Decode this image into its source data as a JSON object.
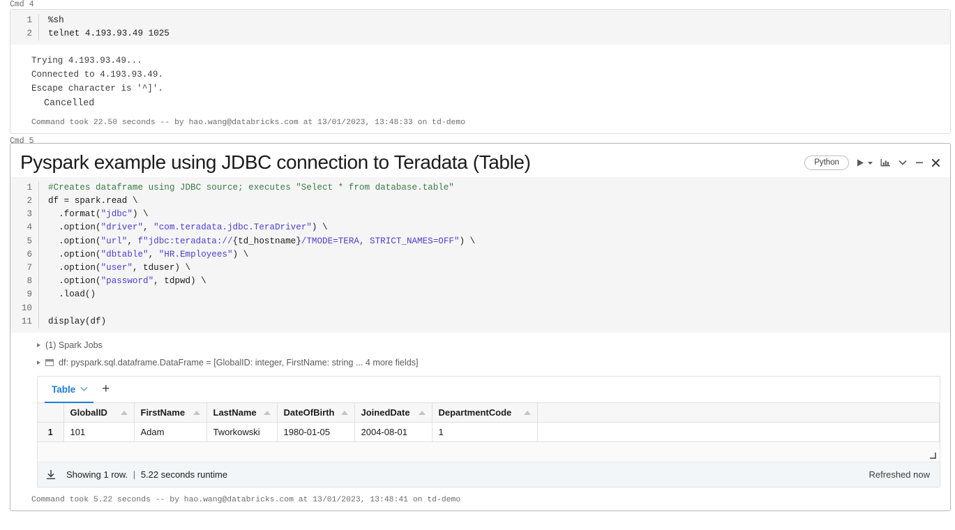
{
  "cmd4": {
    "label": "Cmd 4",
    "code_lines": [
      {
        "n": "1",
        "tokens": [
          {
            "t": "%sh",
            "c": "plain"
          }
        ]
      },
      {
        "n": "2",
        "tokens": [
          {
            "t": "telnet 4.193.93.49 1025",
            "c": "plain"
          }
        ]
      }
    ],
    "output_lines": [
      "Trying 4.193.93.49...",
      "Connected to 4.193.93.49.",
      "Escape character is '^]'."
    ],
    "cancelled": "Cancelled",
    "status": "Command took 22.50 seconds -- by hao.wang@databricks.com at 13/01/2023, 13:48:33 on td-demo"
  },
  "cmd5": {
    "label": "Cmd 5",
    "title": "Pyspark example using JDBC connection to Teradata (Table)",
    "toolbar": {
      "language": "Python",
      "run_icon": "play-icon",
      "run_caret_icon": "caret-down-icon",
      "chart_icon": "bar-chart-icon",
      "collapse_icon": "chevron-down-icon",
      "minimize_icon": "minimize-icon",
      "close_icon": "close-icon"
    },
    "code_lines": [
      {
        "n": "1",
        "tokens": [
          {
            "t": "#Creates dataframe using JDBC source; executes \"Select * from database.table\"",
            "c": "comment"
          }
        ]
      },
      {
        "n": "2",
        "tokens": [
          {
            "t": "df = spark.read \\",
            "c": "plain"
          }
        ]
      },
      {
        "n": "3",
        "tokens": [
          {
            "t": "  .format(",
            "c": "plain"
          },
          {
            "t": "\"jdbc\"",
            "c": "str"
          },
          {
            "t": ") \\",
            "c": "plain"
          }
        ]
      },
      {
        "n": "4",
        "tokens": [
          {
            "t": "  .option(",
            "c": "plain"
          },
          {
            "t": "\"driver\"",
            "c": "str"
          },
          {
            "t": ", ",
            "c": "plain"
          },
          {
            "t": "\"com.teradata.jdbc.TeraDriver\"",
            "c": "str"
          },
          {
            "t": ") \\",
            "c": "plain"
          }
        ]
      },
      {
        "n": "5",
        "tokens": [
          {
            "t": "  .option(",
            "c": "plain"
          },
          {
            "t": "\"url\"",
            "c": "str"
          },
          {
            "t": ", ",
            "c": "plain"
          },
          {
            "t": "f\"jdbc:teradata://",
            "c": "str"
          },
          {
            "t": "{td_hostname}",
            "c": "plain"
          },
          {
            "t": "/TMODE=TERA, STRICT_NAMES=OFF\"",
            "c": "str"
          },
          {
            "t": ") \\",
            "c": "plain"
          }
        ]
      },
      {
        "n": "6",
        "tokens": [
          {
            "t": "  .option(",
            "c": "plain"
          },
          {
            "t": "\"dbtable\"",
            "c": "str"
          },
          {
            "t": ", ",
            "c": "plain"
          },
          {
            "t": "\"HR.Employees\"",
            "c": "str"
          },
          {
            "t": ") \\",
            "c": "plain"
          }
        ]
      },
      {
        "n": "7",
        "tokens": [
          {
            "t": "  .option(",
            "c": "plain"
          },
          {
            "t": "\"user\"",
            "c": "str"
          },
          {
            "t": ", tduser) \\",
            "c": "plain"
          }
        ]
      },
      {
        "n": "8",
        "tokens": [
          {
            "t": "  .option(",
            "c": "plain"
          },
          {
            "t": "\"password\"",
            "c": "str"
          },
          {
            "t": ", tdpwd) \\",
            "c": "plain"
          }
        ]
      },
      {
        "n": "9",
        "tokens": [
          {
            "t": "  .load()",
            "c": "plain"
          }
        ]
      },
      {
        "n": "10",
        "tokens": [
          {
            "t": "",
            "c": "plain"
          }
        ]
      },
      {
        "n": "11",
        "tokens": [
          {
            "t": "display(df)",
            "c": "plain"
          }
        ]
      }
    ],
    "spark_jobs_label": "(1) Spark Jobs",
    "dataframe_label": "df:  pyspark.sql.dataframe.DataFrame = [GlobalID: integer, FirstName: string ... 4 more fields]",
    "tabs": {
      "table_label": "Table",
      "add_label": "+"
    },
    "table": {
      "rownum_header": "",
      "columns": [
        "GlobalID",
        "FirstName",
        "LastName",
        "DateOfBirth",
        "JoinedDate",
        "DepartmentCode"
      ],
      "rows": [
        {
          "num": "1",
          "cells": [
            "101",
            "Adam",
            "Tworkowski",
            "1980-01-05",
            "2004-08-01",
            "1"
          ]
        }
      ]
    },
    "footer": {
      "download_icon": "download-icon",
      "showing": "Showing 1 row.",
      "separator": "|",
      "runtime": "5.22 seconds runtime",
      "refreshed": "Refreshed now"
    },
    "status": "Command took 5.22 seconds -- by hao.wang@databricks.com at 13/01/2023, 13:48:41 on td-demo"
  },
  "colors": {
    "accent_blue": "#1f7bd4",
    "comment_green": "#3a7a42",
    "string_blue": "#4a3fd1",
    "editor_bg": "#f5f5f5",
    "footer_bg": "#f3f6f8"
  }
}
